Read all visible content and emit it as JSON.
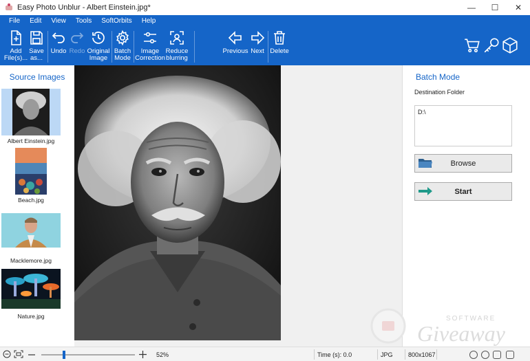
{
  "window": {
    "title": "Easy Photo Unblur - Albert Einstein.jpg*",
    "controls": {
      "minimize": "—",
      "maximize": "☐",
      "close": "✕"
    }
  },
  "menu": [
    "File",
    "Edit",
    "View",
    "Tools",
    "SoftOrbits",
    "Help"
  ],
  "toolbar": {
    "add": "Add\nFile(s)...",
    "save": "Save\nas...",
    "undo": "Undo",
    "redo": "Redo",
    "original": "Original\nImage",
    "batch": "Batch\nMode",
    "image_correction": "Image\nCorrection",
    "reduce_blurring": "Reduce\nblurring",
    "previous": "Previous",
    "next": "Next",
    "delete": "Delete"
  },
  "source_panel": {
    "title": "Source Images",
    "items": [
      {
        "name": "Albert Einstein.jpg",
        "selected": true
      },
      {
        "name": "Beach.jpg",
        "selected": false
      },
      {
        "name": "Macklemore.jpg",
        "selected": false
      },
      {
        "name": "Nature.jpg",
        "selected": false
      }
    ]
  },
  "batch_panel": {
    "title": "Batch Mode",
    "destination_label": "Destination Folder",
    "destination_value": "D:\\",
    "browse_label": "Browse",
    "start_label": "Start"
  },
  "status": {
    "zoom_percent": "52%",
    "zoom_level": 0.52,
    "time": "Time (s): 0.0",
    "format": "JPG",
    "dimensions": "800x1067"
  },
  "watermark": {
    "top": "SOFTWARE",
    "bottom": "Giveaway"
  },
  "colors": {
    "accent": "#1565c8",
    "selected": "#bcd8f5"
  }
}
